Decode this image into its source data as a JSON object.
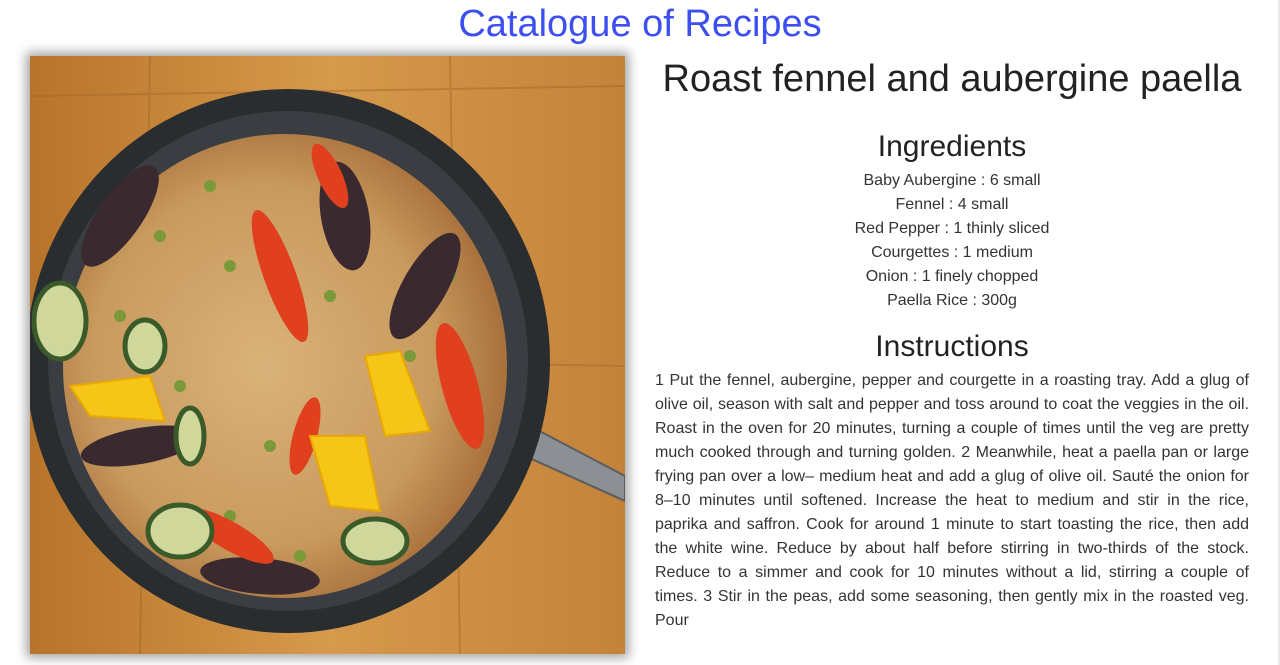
{
  "site": {
    "title": "Catalogue of Recipes"
  },
  "recipe": {
    "title": "Roast fennel and aubergine paella",
    "image_subject": "paella-pan",
    "ingredients_heading": "Ingredients",
    "ingredients": [
      "Baby Aubergine : 6 small",
      "Fennel : 4 small",
      "Red Pepper : 1 thinly sliced",
      "Courgettes : 1 medium",
      "Onion : 1 finely chopped",
      "Paella Rice : 300g"
    ],
    "instructions_heading": "Instructions",
    "instructions": "1 Put the fennel, aubergine, pepper and courgette in a roasting tray. Add a glug of olive oil, season with salt and pepper and toss around to coat the veggies in the oil. Roast in the oven for 20 minutes, turning a couple of times until the veg are pretty much cooked through and turning golden. 2 Meanwhile, heat a paella pan or large frying pan over a low– medium heat and add a glug of olive oil. Sauté the onion for 8–10 minutes until softened. Increase the heat to medium and stir in the rice, paprika and saffron. Cook for around 1 minute to start toasting the rice, then add the white wine. Reduce by about half before stirring in two-thirds of the stock. Reduce to a simmer and cook for 10 minutes without a lid, stirring a couple of times. 3 Stir in the peas, add some seasoning, then gently mix in the roasted veg. Pour"
  },
  "colors": {
    "title_accent": "#3d4ff0",
    "text": "#333333",
    "wood": "#c98a3a",
    "pan": "#2a2d30"
  }
}
